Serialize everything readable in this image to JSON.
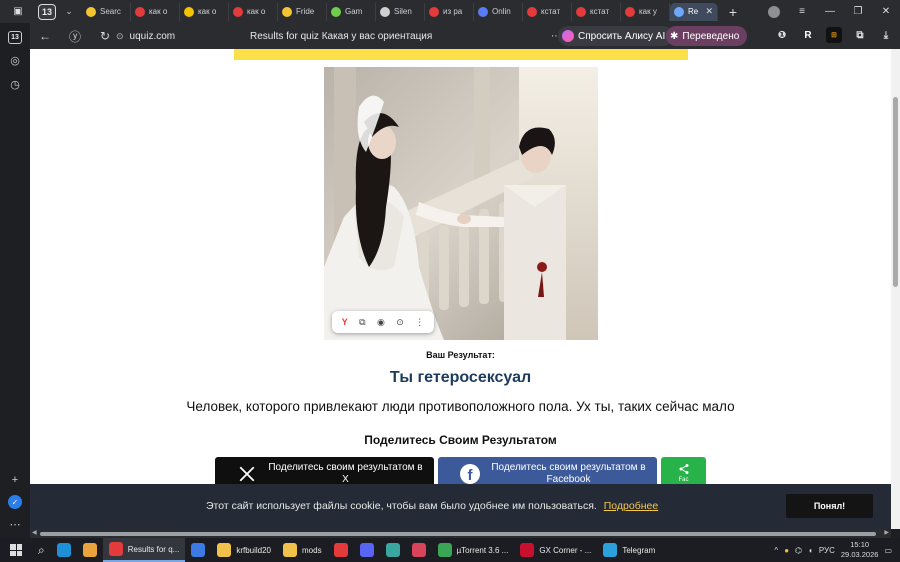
{
  "browser": {
    "tab_counter": "13",
    "tabs": [
      {
        "label": "Searc",
        "color": "#f3c531",
        "icon": "crescent-icon"
      },
      {
        "label": "как о",
        "color": "#e33b3b",
        "icon": "yandex-icon"
      },
      {
        "label": "как о",
        "color": "#f2c500",
        "icon": "play-icon"
      },
      {
        "label": "как о",
        "color": "#e33b3b",
        "icon": "yandex-icon"
      },
      {
        "label": "Fride",
        "color": "#f3c531",
        "icon": "crescent-icon"
      },
      {
        "label": "Gam",
        "color": "#6fcf4a",
        "icon": "gamma-icon"
      },
      {
        "label": "Silen",
        "color": "#cfcfcf",
        "icon": "document-icon"
      },
      {
        "label": "из ра",
        "color": "#e33b3b",
        "icon": "yandex-icon"
      },
      {
        "label": "Onlin",
        "color": "#5b7cf7",
        "icon": "globe-icon"
      },
      {
        "label": "кстат",
        "color": "#e33b3b",
        "icon": "yandex-icon"
      },
      {
        "label": "кстат",
        "color": "#e33b3b",
        "icon": "lightning-icon"
      },
      {
        "label": "как у",
        "color": "#e33b3b",
        "icon": "yandex-icon"
      },
      {
        "label": "Re",
        "color": "#6fa8ff",
        "icon": "uquiz-icon",
        "active": true
      }
    ],
    "url": "uquiz.com",
    "page_title": "Results for quiz Какая у вас ориентация",
    "alice_label": "Спросить Алису AI",
    "translated_label": "Переведено",
    "sidebar_badge": "13"
  },
  "page": {
    "result_label": "Ваш Результат:",
    "result_title": "Ты гетеросексуал",
    "result_description": "Человек, которого привлекают люди противоположного пола. Ух ты, таких сейчас мало",
    "share_title": "Поделитесь Своим Результатом",
    "share_x": "Поделитесь своим результатом в X",
    "share_facebook": "Поделитесь своим результатом в Facebook",
    "share_more": "Fac"
  },
  "cookie": {
    "text": "Этот сайт использует файлы cookie, чтобы вам было удобнее им пользоваться.",
    "link": "Подробнее",
    "button": "Понял!"
  },
  "taskbar": {
    "apps": [
      {
        "label": "",
        "icon": "edge-icon",
        "color": "#1f8fd6"
      },
      {
        "label": "",
        "icon": "chrome-icon",
        "color": "#e9a53b"
      },
      {
        "label": "Results for q...",
        "icon": "yandex-browser-icon",
        "color": "#e33b3b",
        "active": true
      },
      {
        "label": "",
        "icon": "store-icon",
        "color": "#3b7be3"
      },
      {
        "label": "krfbuild20",
        "icon": "folder-icon",
        "color": "#f0c14b"
      },
      {
        "label": "mods",
        "icon": "folder-icon",
        "color": "#f0c14b"
      },
      {
        "label": "",
        "icon": "yandex-icon",
        "color": "#e33b3b"
      },
      {
        "label": "",
        "icon": "discord-icon",
        "color": "#5865f2"
      },
      {
        "label": "",
        "icon": "cursor-icon",
        "color": "#3aa6a0"
      },
      {
        "label": "",
        "icon": "app-icon",
        "color": "#d9445a"
      },
      {
        "label": "µTorrent 3.6 ...",
        "icon": "utorrent-icon",
        "color": "#3aa655"
      },
      {
        "label": "GX Corner - ...",
        "icon": "opera-gx-icon",
        "color": "#c8102e"
      },
      {
        "label": "Telegram",
        "icon": "telegram-icon",
        "color": "#2aa1da"
      }
    ],
    "lang": "РУС",
    "time": "15:10",
    "date": "29.03.2026"
  }
}
